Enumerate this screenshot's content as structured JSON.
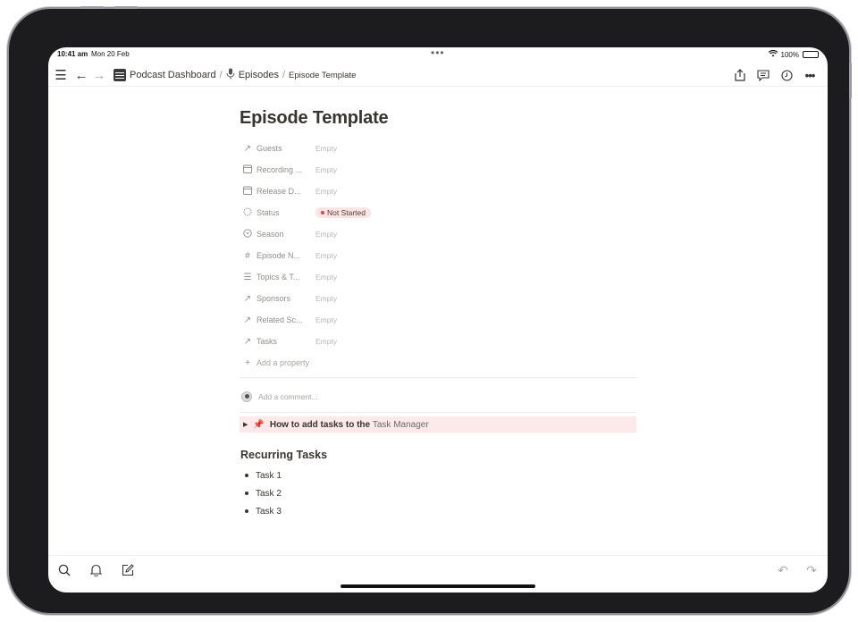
{
  "status_bar": {
    "time": "10:41 am",
    "date": "Mon 20 Feb",
    "battery": "100%"
  },
  "breadcrumbs": [
    {
      "label": "Podcast Dashboard",
      "icon": "dashboard-icon"
    },
    {
      "label": "Episodes",
      "icon": "microphone-icon"
    },
    {
      "label": "Episode Template"
    }
  ],
  "page": {
    "title": "Episode Template",
    "properties": [
      {
        "icon": "relation-arrow-icon",
        "name": "Guests",
        "value": "Empty"
      },
      {
        "icon": "calendar-icon",
        "name": "Recording ...",
        "value": "Empty"
      },
      {
        "icon": "calendar-icon",
        "name": "Release D...",
        "value": "Empty"
      },
      {
        "icon": "status-icon",
        "name": "Status",
        "value": "Not Started"
      },
      {
        "icon": "select-icon",
        "name": "Season",
        "value": "Empty"
      },
      {
        "icon": "hash-icon",
        "name": "Episode N...",
        "value": "Empty"
      },
      {
        "icon": "list-icon",
        "name": "Topics & T...",
        "value": "Empty"
      },
      {
        "icon": "relation-arrow-icon",
        "name": "Sponsors",
        "value": "Empty"
      },
      {
        "icon": "relation-arrow-icon",
        "name": "Related Sc...",
        "value": "Empty"
      },
      {
        "icon": "relation-arrow-icon",
        "name": "Tasks",
        "value": "Empty"
      }
    ],
    "add_property": "Add a property",
    "comment_placeholder": "Add a comment...",
    "toggle": {
      "emoji": "📌",
      "text": "How to add tasks to the",
      "link": "Task Manager"
    },
    "section_heading": "Recurring Tasks",
    "tasks": [
      "Task 1",
      "Task 2",
      "Task 3"
    ]
  },
  "colors": {
    "status_badge_bg": "#fbe4e4",
    "status_dot": "#d44c47",
    "toggle_bg": "#fde9ea"
  }
}
